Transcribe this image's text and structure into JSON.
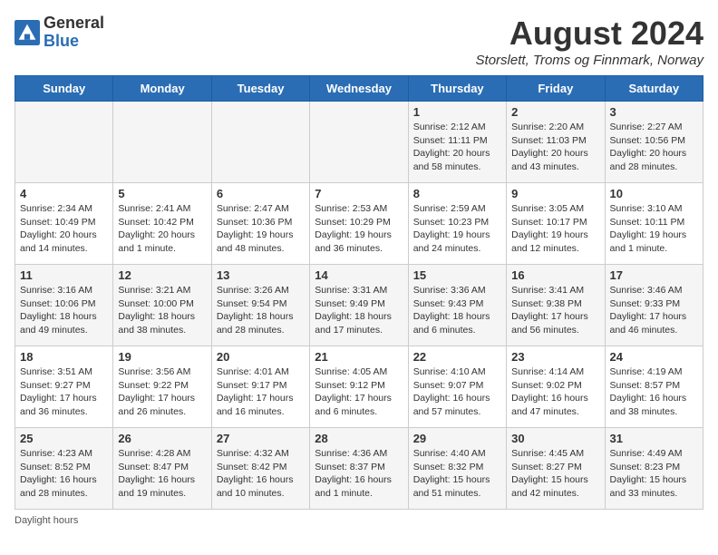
{
  "header": {
    "logo_general": "General",
    "logo_blue": "Blue",
    "month_year": "August 2024",
    "location": "Storslett, Troms og Finnmark, Norway"
  },
  "days_of_week": [
    "Sunday",
    "Monday",
    "Tuesday",
    "Wednesday",
    "Thursday",
    "Friday",
    "Saturday"
  ],
  "weeks": [
    [
      {
        "day": "",
        "info": ""
      },
      {
        "day": "",
        "info": ""
      },
      {
        "day": "",
        "info": ""
      },
      {
        "day": "",
        "info": ""
      },
      {
        "day": "1",
        "info": "Sunrise: 2:12 AM\nSunset: 11:11 PM\nDaylight: 20 hours\nand 58 minutes."
      },
      {
        "day": "2",
        "info": "Sunrise: 2:20 AM\nSunset: 11:03 PM\nDaylight: 20 hours\nand 43 minutes."
      },
      {
        "day": "3",
        "info": "Sunrise: 2:27 AM\nSunset: 10:56 PM\nDaylight: 20 hours\nand 28 minutes."
      }
    ],
    [
      {
        "day": "4",
        "info": "Sunrise: 2:34 AM\nSunset: 10:49 PM\nDaylight: 20 hours\nand 14 minutes."
      },
      {
        "day": "5",
        "info": "Sunrise: 2:41 AM\nSunset: 10:42 PM\nDaylight: 20 hours\nand 1 minute."
      },
      {
        "day": "6",
        "info": "Sunrise: 2:47 AM\nSunset: 10:36 PM\nDaylight: 19 hours\nand 48 minutes."
      },
      {
        "day": "7",
        "info": "Sunrise: 2:53 AM\nSunset: 10:29 PM\nDaylight: 19 hours\nand 36 minutes."
      },
      {
        "day": "8",
        "info": "Sunrise: 2:59 AM\nSunset: 10:23 PM\nDaylight: 19 hours\nand 24 minutes."
      },
      {
        "day": "9",
        "info": "Sunrise: 3:05 AM\nSunset: 10:17 PM\nDaylight: 19 hours\nand 12 minutes."
      },
      {
        "day": "10",
        "info": "Sunrise: 3:10 AM\nSunset: 10:11 PM\nDaylight: 19 hours\nand 1 minute."
      }
    ],
    [
      {
        "day": "11",
        "info": "Sunrise: 3:16 AM\nSunset: 10:06 PM\nDaylight: 18 hours\nand 49 minutes."
      },
      {
        "day": "12",
        "info": "Sunrise: 3:21 AM\nSunset: 10:00 PM\nDaylight: 18 hours\nand 38 minutes."
      },
      {
        "day": "13",
        "info": "Sunrise: 3:26 AM\nSunset: 9:54 PM\nDaylight: 18 hours\nand 28 minutes."
      },
      {
        "day": "14",
        "info": "Sunrise: 3:31 AM\nSunset: 9:49 PM\nDaylight: 18 hours\nand 17 minutes."
      },
      {
        "day": "15",
        "info": "Sunrise: 3:36 AM\nSunset: 9:43 PM\nDaylight: 18 hours\nand 6 minutes."
      },
      {
        "day": "16",
        "info": "Sunrise: 3:41 AM\nSunset: 9:38 PM\nDaylight: 17 hours\nand 56 minutes."
      },
      {
        "day": "17",
        "info": "Sunrise: 3:46 AM\nSunset: 9:33 PM\nDaylight: 17 hours\nand 46 minutes."
      }
    ],
    [
      {
        "day": "18",
        "info": "Sunrise: 3:51 AM\nSunset: 9:27 PM\nDaylight: 17 hours\nand 36 minutes."
      },
      {
        "day": "19",
        "info": "Sunrise: 3:56 AM\nSunset: 9:22 PM\nDaylight: 17 hours\nand 26 minutes."
      },
      {
        "day": "20",
        "info": "Sunrise: 4:01 AM\nSunset: 9:17 PM\nDaylight: 17 hours\nand 16 minutes."
      },
      {
        "day": "21",
        "info": "Sunrise: 4:05 AM\nSunset: 9:12 PM\nDaylight: 17 hours\nand 6 minutes."
      },
      {
        "day": "22",
        "info": "Sunrise: 4:10 AM\nSunset: 9:07 PM\nDaylight: 16 hours\nand 57 minutes."
      },
      {
        "day": "23",
        "info": "Sunrise: 4:14 AM\nSunset: 9:02 PM\nDaylight: 16 hours\nand 47 minutes."
      },
      {
        "day": "24",
        "info": "Sunrise: 4:19 AM\nSunset: 8:57 PM\nDaylight: 16 hours\nand 38 minutes."
      }
    ],
    [
      {
        "day": "25",
        "info": "Sunrise: 4:23 AM\nSunset: 8:52 PM\nDaylight: 16 hours\nand 28 minutes."
      },
      {
        "day": "26",
        "info": "Sunrise: 4:28 AM\nSunset: 8:47 PM\nDaylight: 16 hours\nand 19 minutes."
      },
      {
        "day": "27",
        "info": "Sunrise: 4:32 AM\nSunset: 8:42 PM\nDaylight: 16 hours\nand 10 minutes."
      },
      {
        "day": "28",
        "info": "Sunrise: 4:36 AM\nSunset: 8:37 PM\nDaylight: 16 hours\nand 1 minute."
      },
      {
        "day": "29",
        "info": "Sunrise: 4:40 AM\nSunset: 8:32 PM\nDaylight: 15 hours\nand 51 minutes."
      },
      {
        "day": "30",
        "info": "Sunrise: 4:45 AM\nSunset: 8:27 PM\nDaylight: 15 hours\nand 42 minutes."
      },
      {
        "day": "31",
        "info": "Sunrise: 4:49 AM\nSunset: 8:23 PM\nDaylight: 15 hours\nand 33 minutes."
      }
    ]
  ],
  "footer": {
    "daylight_label": "Daylight hours"
  }
}
